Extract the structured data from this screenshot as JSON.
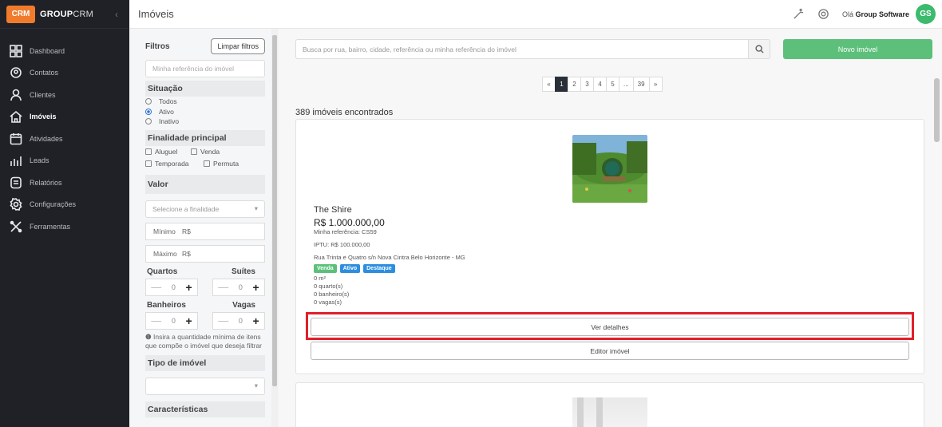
{
  "brand": {
    "logo": "CRM",
    "name_bold": "GROUP",
    "name_rest": "CRM"
  },
  "sidebar": {
    "items": [
      {
        "label": "Dashboard",
        "icon": "dashboard-icon"
      },
      {
        "label": "Contatos",
        "icon": "contacts-icon"
      },
      {
        "label": "Clientes",
        "icon": "clients-icon"
      },
      {
        "label": "Imóveis",
        "icon": "home-icon",
        "active": true
      },
      {
        "label": "Atividades",
        "icon": "calendar-icon"
      },
      {
        "label": "Leads",
        "icon": "leads-icon"
      },
      {
        "label": "Relatórios",
        "icon": "reports-icon"
      },
      {
        "label": "Configurações",
        "icon": "gear-icon"
      },
      {
        "label": "Ferramentas",
        "icon": "tools-icon"
      }
    ]
  },
  "header": {
    "title": "Imóveis",
    "greeting": "Olá",
    "user_name": "Group Software",
    "avatar_initials": "GS"
  },
  "filters": {
    "title": "Filtros",
    "clear_label": "Limpar filtros",
    "reference_placeholder": "Minha referência do imóvel",
    "situation": {
      "title": "Situação",
      "options": [
        "Todos",
        "Ativo",
        "Inativo"
      ],
      "selected": "Ativo"
    },
    "purpose": {
      "title": "Finalidade principal",
      "options": [
        "Aluguel",
        "Venda",
        "Temporada",
        "Permuta"
      ]
    },
    "value": {
      "title": "Valor",
      "select_placeholder": "Selecione a finalidade",
      "min_label": "Mínimo",
      "max_label": "Máximo",
      "currency": "R$"
    },
    "counters": [
      {
        "label": "Quartos",
        "value": "0"
      },
      {
        "label": "Suítes",
        "value": "0"
      },
      {
        "label": "Banheiros",
        "value": "0"
      },
      {
        "label": "Vagas",
        "value": "0"
      }
    ],
    "hint": "Insira a quantidade mínima de itens que compõe o imóvel que deseja filtrar",
    "type_title": "Tipo de imóvel",
    "features_title": "Características"
  },
  "main": {
    "search_placeholder": "Busca por rua, bairro, cidade, referência ou minha referência do imóvel",
    "new_button": "Novo imóvel",
    "pagination": [
      "«",
      "1",
      "2",
      "3",
      "4",
      "5",
      "...",
      "39",
      "»"
    ],
    "pagination_active": "1",
    "results_count": "389 imóveis encontrados",
    "property": {
      "title": "The Shire",
      "price": "R$ 1.000.000,00",
      "reference": "Minha referência: CS59",
      "iptu": "IPTU: R$ 100.000,00",
      "address": "Rua Trinta e Quatro s/n Nova Cintra Belo Horizonte - MG",
      "badges": [
        "Venda",
        "Ativo",
        "Destaque"
      ],
      "area": "0 m²",
      "bedrooms": "0 quarto(s)",
      "bathrooms": "0 banheiro(s)",
      "parking": "0 vagas(s)",
      "details_button": "Ver detalhes",
      "edit_button": "Editor imóvel"
    }
  },
  "colors": {
    "accent_green": "#5cc07a",
    "highlight_red": "#e0202a",
    "sidebar_bg": "#1f2126"
  }
}
